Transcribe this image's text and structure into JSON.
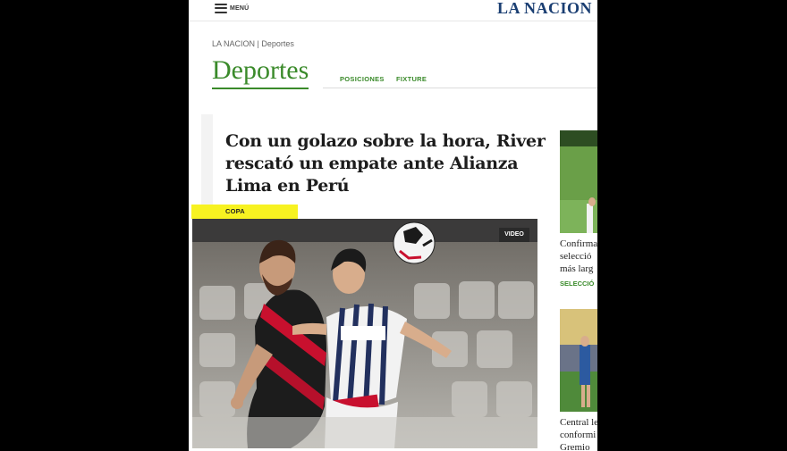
{
  "header": {
    "menu_label": "MENÚ",
    "logo_text": "LA NACION"
  },
  "section": {
    "breadcrumb": "LA NACION | Deportes",
    "title": "Deportes",
    "tabs": [
      {
        "label": "POSICIONES"
      },
      {
        "label": "FIXTURE"
      }
    ],
    "accent_color": "#3a8a2a"
  },
  "main_article": {
    "headline": "Con un golazo sobre la hora, River rescató un empate ante Alianza Lima en Perú",
    "category": "COPA LIBERTADORES",
    "video_badge": "VIDEO",
    "tag_color": "#f7f221"
  },
  "sidebar": {
    "cards": [
      {
        "text_lines": [
          "Confirma",
          "selecció",
          "más larg"
        ],
        "category": "SELECCIÓ"
      },
      {
        "text_lines": [
          "Central le",
          "conformi",
          "Gremio"
        ]
      }
    ]
  }
}
